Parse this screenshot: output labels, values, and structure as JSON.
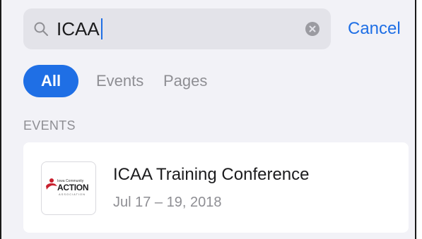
{
  "search": {
    "query": "ICAA",
    "cancel_label": "Cancel"
  },
  "filters": {
    "items": [
      {
        "label": "All",
        "selected": true
      },
      {
        "label": "Events",
        "selected": false
      },
      {
        "label": "Pages",
        "selected": false
      }
    ]
  },
  "sections": [
    {
      "header": "EVENTS",
      "items": [
        {
          "title": "ICAA Training Conference",
          "date": "Jul 17 – 19, 2018",
          "logo": {
            "line1": "Iowa Community",
            "line2": "ACTION",
            "line3": "ASSOCIATION"
          }
        }
      ]
    }
  ],
  "colors": {
    "accent": "#1f6fe5",
    "background": "#f2f2f7",
    "secondary_text": "#8e8e93",
    "logo_red": "#c8202e"
  },
  "icons": {
    "search": "search-icon",
    "clear": "clear-icon"
  }
}
